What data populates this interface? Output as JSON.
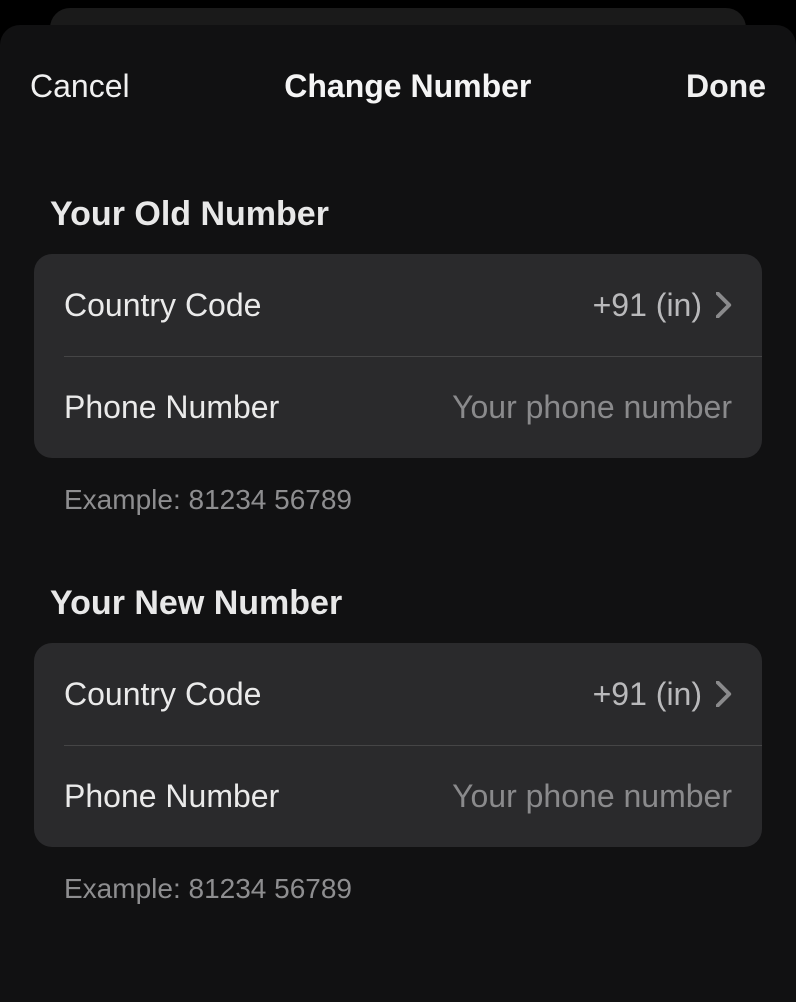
{
  "nav": {
    "cancel": "Cancel",
    "title": "Change Number",
    "done": "Done"
  },
  "old_section": {
    "header": "Your Old Number",
    "country_code_label": "Country Code",
    "country_code_value": "+91 (in)",
    "phone_label": "Phone Number",
    "phone_placeholder": "Your phone number",
    "phone_value": "",
    "example": "Example:  81234 56789"
  },
  "new_section": {
    "header": "Your New Number",
    "country_code_label": "Country Code",
    "country_code_value": "+91 (in)",
    "phone_label": "Phone Number",
    "phone_placeholder": "Your phone number",
    "phone_value": "",
    "example": "Example:  81234 56789"
  }
}
